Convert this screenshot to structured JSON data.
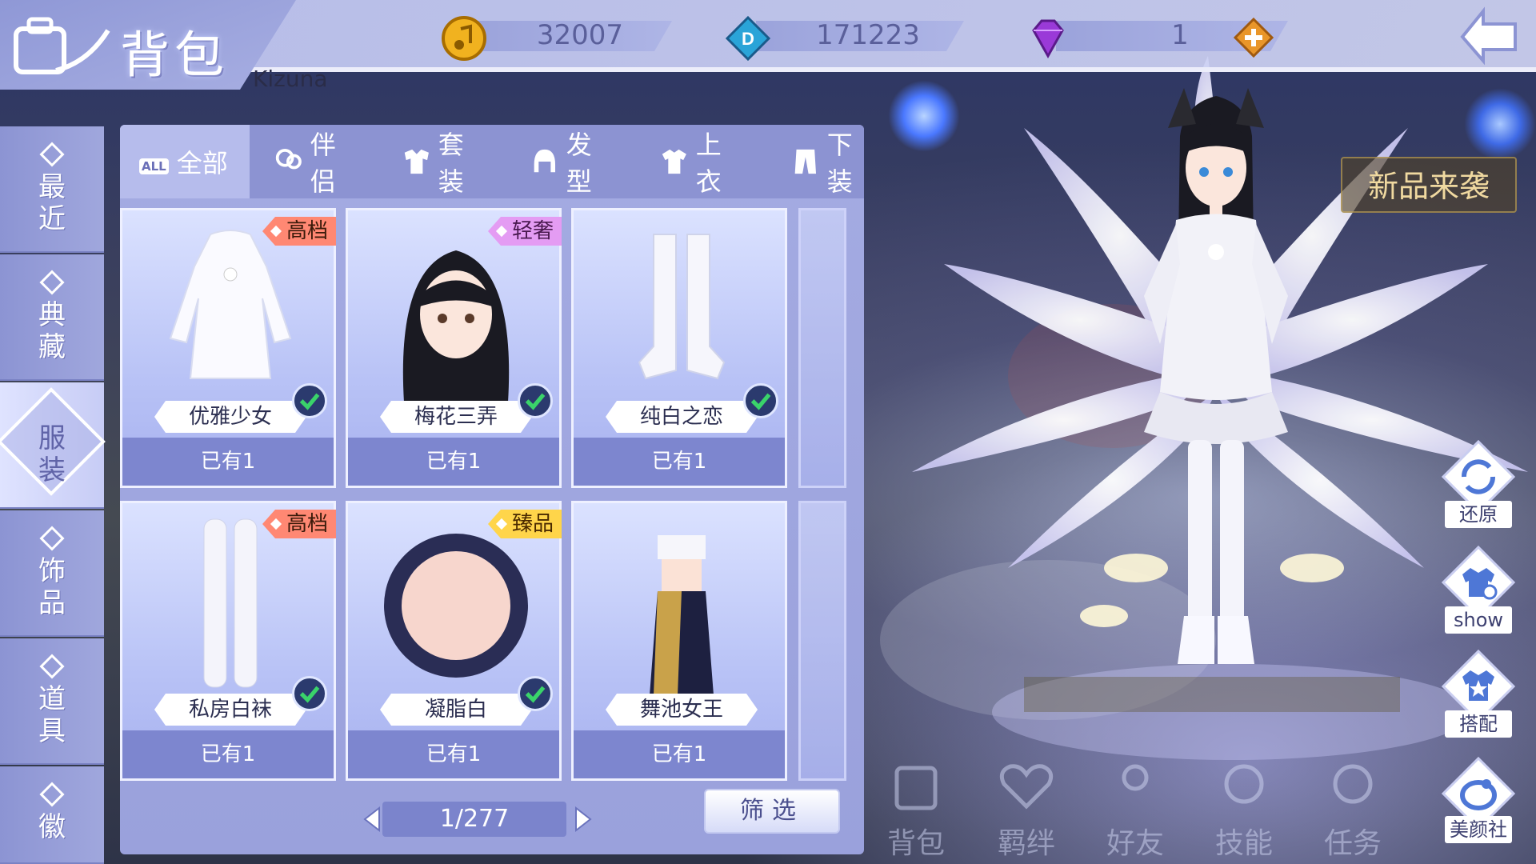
{
  "header": {
    "title": "背包",
    "player_name": "Kizuna"
  },
  "currencies": [
    {
      "icon": "music-note-coin-icon",
      "value": "32007"
    },
    {
      "icon": "diamond-d-coin-icon",
      "value": "171223"
    },
    {
      "icon": "purple-gem-icon",
      "value": "1"
    }
  ],
  "left_nav": {
    "items": [
      {
        "label": "最近"
      },
      {
        "label": "典藏"
      },
      {
        "label": "服装",
        "active": true
      },
      {
        "label": "饰品"
      },
      {
        "label": "道具"
      },
      {
        "label": "徽"
      }
    ]
  },
  "tabs": [
    {
      "label": "全部",
      "badge": "ALL",
      "active": true
    },
    {
      "label": "伴侣"
    },
    {
      "label": "套装"
    },
    {
      "label": "发型"
    },
    {
      "label": "上衣"
    },
    {
      "label": "下装"
    }
  ],
  "items": [
    {
      "name": "优雅少女",
      "owned": "已有1",
      "tag": "高档",
      "tag_color": "red",
      "equipped": true
    },
    {
      "name": "梅花三弄",
      "owned": "已有1",
      "tag": "轻奢",
      "tag_color": "pink",
      "equipped": true
    },
    {
      "name": "纯白之恋",
      "owned": "已有1",
      "tag": "",
      "equipped": true
    },
    {
      "name": "私房白袜",
      "owned": "已有1",
      "tag": "高档",
      "tag_color": "red",
      "equipped": true
    },
    {
      "name": "凝脂白",
      "owned": "已有1",
      "tag": "臻品",
      "tag_color": "gold",
      "equipped": true
    },
    {
      "name": "舞池女王",
      "owned": "已有1",
      "tag": "",
      "equipped": false
    }
  ],
  "pager": {
    "text": "1/277"
  },
  "filter_label": "筛选",
  "new_arrival": "新品来袭",
  "right_buttons": [
    {
      "label": "还原",
      "icon": "restore-icon"
    },
    {
      "label": "show",
      "icon": "show-camera-icon"
    },
    {
      "label": "搭配",
      "icon": "outfit-match-icon"
    },
    {
      "label": "美颜社",
      "icon": "beauty-club-icon"
    }
  ],
  "bottom_nav": [
    {
      "label": "背包"
    },
    {
      "label": "羁绊"
    },
    {
      "label": "好友"
    },
    {
      "label": "技能"
    },
    {
      "label": "任务"
    }
  ],
  "colors": {
    "panel": "#9aa1dc",
    "nav": "#8c94d3",
    "tag_red": "#ff8873",
    "tag_pink": "#e49cf3",
    "tag_gold": "#ffd54a",
    "check_green": "#3ad36a"
  }
}
